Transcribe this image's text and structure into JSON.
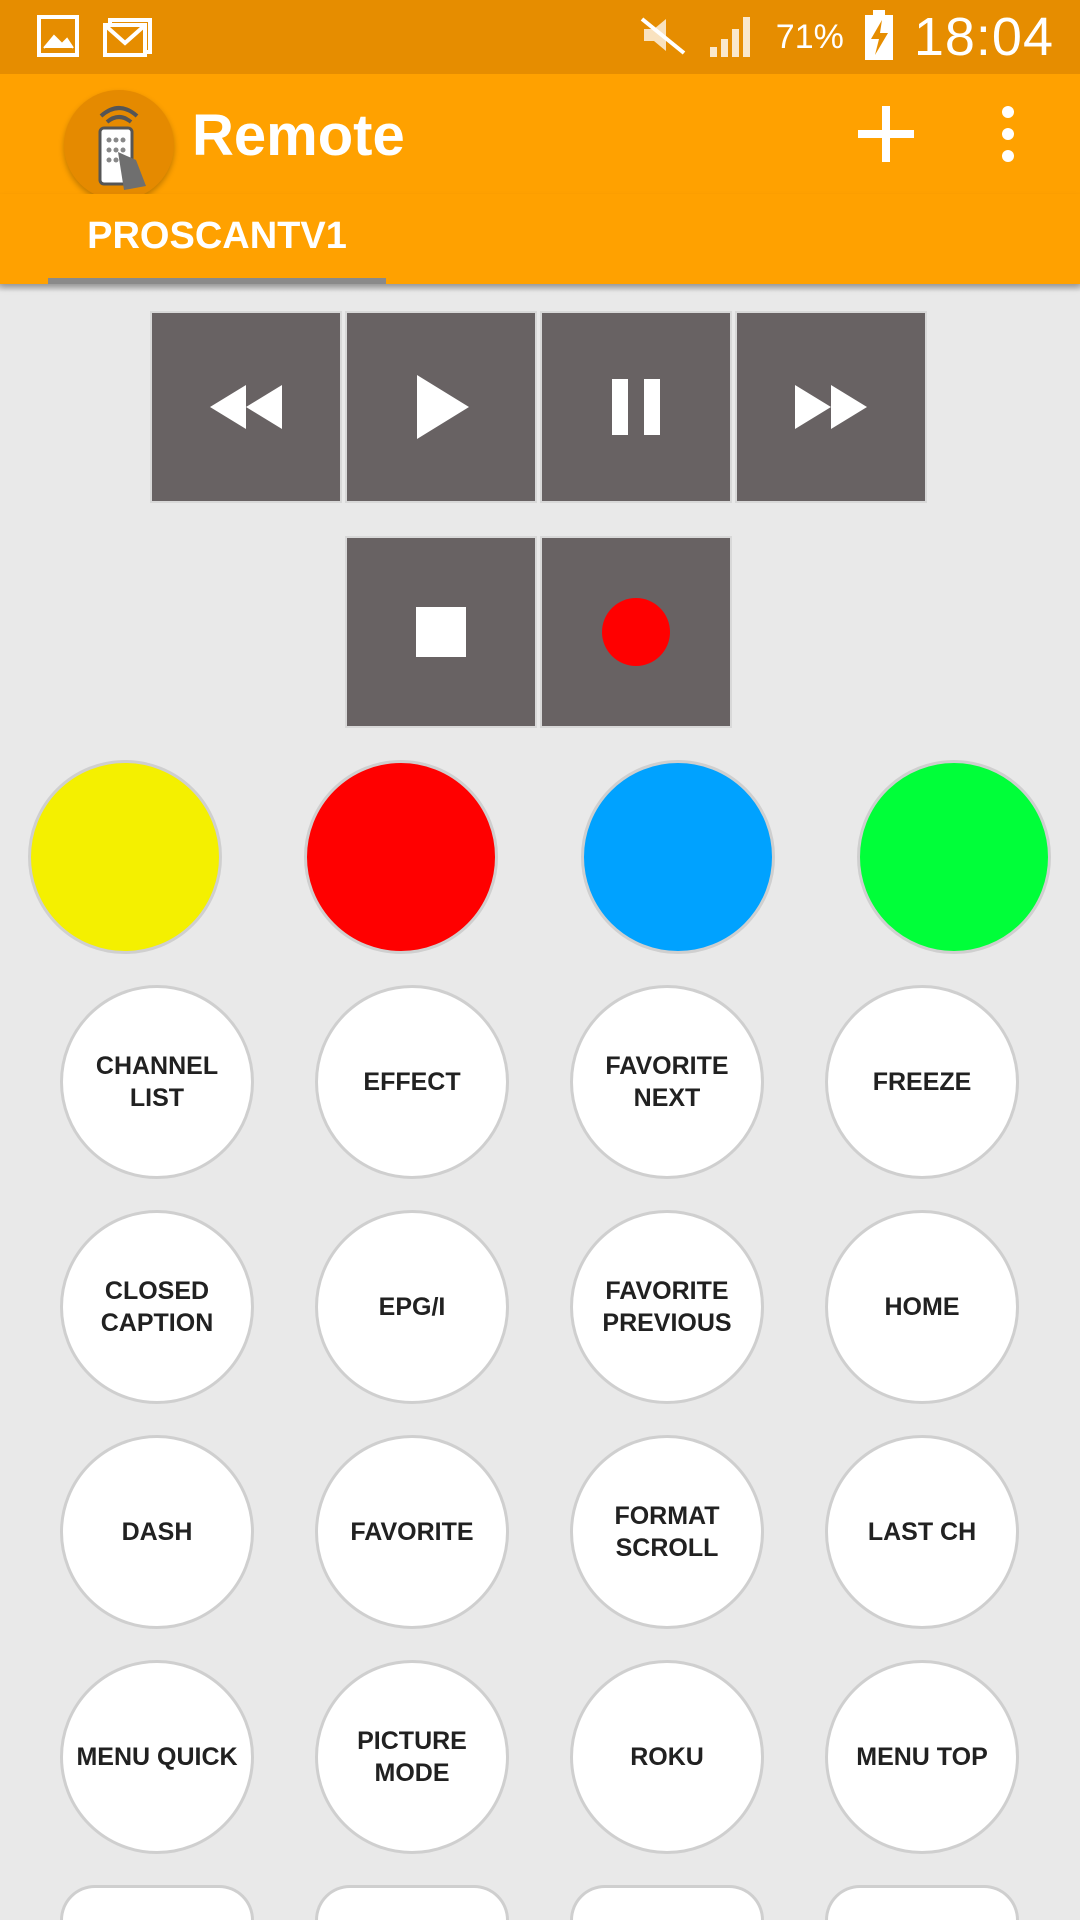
{
  "status_bar": {
    "battery_percent": "71%",
    "time": "18:04",
    "icons": [
      "gallery-icon",
      "gmail-icon",
      "mute-icon",
      "signal-icon",
      "battery-charging-icon"
    ]
  },
  "app_bar": {
    "title": "Remote",
    "add_icon": "plus-icon",
    "menu_icon": "overflow-menu-icon",
    "logo_icon": "remote-control-icon"
  },
  "tabs": [
    {
      "label": "PROSCANTV1",
      "selected": true
    }
  ],
  "media_controls": [
    {
      "icon": "rewind-icon"
    },
    {
      "icon": "play-icon"
    },
    {
      "icon": "pause-icon"
    },
    {
      "icon": "fast-forward-icon"
    },
    {
      "icon": "stop-icon"
    },
    {
      "icon": "record-icon",
      "color": "#ff0000"
    }
  ],
  "color_buttons": [
    {
      "name": "yellow",
      "color": "#f4f000"
    },
    {
      "name": "red",
      "color": "#ff0000"
    },
    {
      "name": "blue",
      "color": "#00a2ff"
    },
    {
      "name": "green",
      "color": "#00ff39"
    }
  ],
  "buttons": [
    {
      "label": "CHANNEL LIST"
    },
    {
      "label": "EFFECT"
    },
    {
      "label": "FAVORITE NEXT"
    },
    {
      "label": "FREEZE"
    },
    {
      "label": "CLOSED\nCAPTION"
    },
    {
      "label": "EPG/I"
    },
    {
      "label": "FAVORITE\nPREVIOUS"
    },
    {
      "label": "HOME"
    },
    {
      "label": "DASH"
    },
    {
      "label": "FAVORITE"
    },
    {
      "label": "FORMAT\nSCROLL"
    },
    {
      "label": "LAST CH"
    },
    {
      "label": "MENU QUICK"
    },
    {
      "label": "PICTURE MODE"
    },
    {
      "label": "ROKU"
    },
    {
      "label": "MENU TOP"
    }
  ]
}
